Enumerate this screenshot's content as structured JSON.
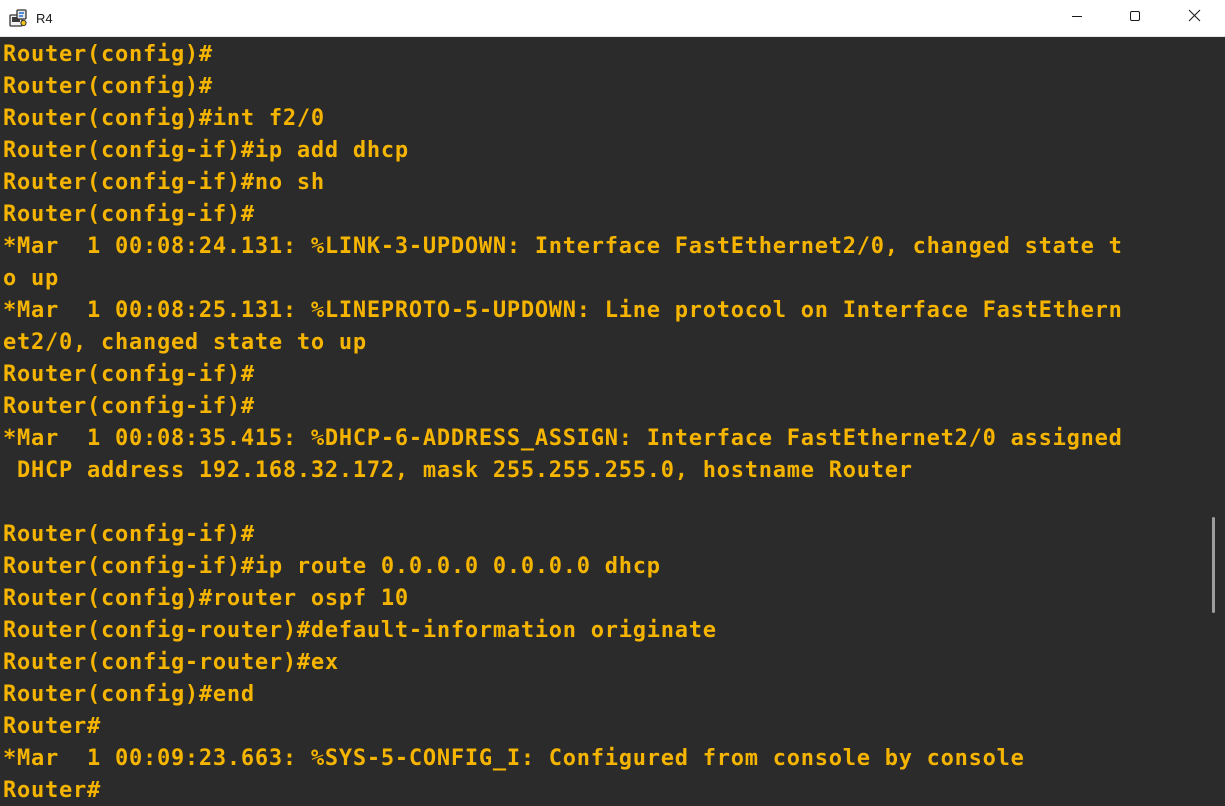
{
  "window": {
    "title": "R4",
    "icon": "router-console-icon",
    "controls": {
      "minimize_icon": "minimize-icon",
      "maximize_icon": "maximize-icon",
      "close_icon": "close-icon"
    }
  },
  "terminal": {
    "text_color": "#f5b400",
    "background_color": "#2b2b2b",
    "lines": [
      "Router(config)#",
      "Router(config)#",
      "Router(config)#int f2/0",
      "Router(config-if)#ip add dhcp",
      "Router(config-if)#no sh",
      "Router(config-if)#",
      "*Mar  1 00:08:24.131: %LINK-3-UPDOWN: Interface FastEthernet2/0, changed state t",
      "o up",
      "*Mar  1 00:08:25.131: %LINEPROTO-5-UPDOWN: Line protocol on Interface FastEthern",
      "et2/0, changed state to up",
      "Router(config-if)#",
      "Router(config-if)#",
      "*Mar  1 00:08:35.415: %DHCP-6-ADDRESS_ASSIGN: Interface FastEthernet2/0 assigned",
      " DHCP address 192.168.32.172, mask 255.255.255.0, hostname Router",
      "",
      "Router(config-if)#",
      "Router(config-if)#ip route 0.0.0.0 0.0.0.0 dhcp",
      "Router(config)#router ospf 10",
      "Router(config-router)#default-information originate",
      "Router(config-router)#ex",
      "Router(config)#end",
      "Router#",
      "*Mar  1 00:09:23.663: %SYS-5-CONFIG_I: Configured from console by console",
      "Router#"
    ]
  }
}
